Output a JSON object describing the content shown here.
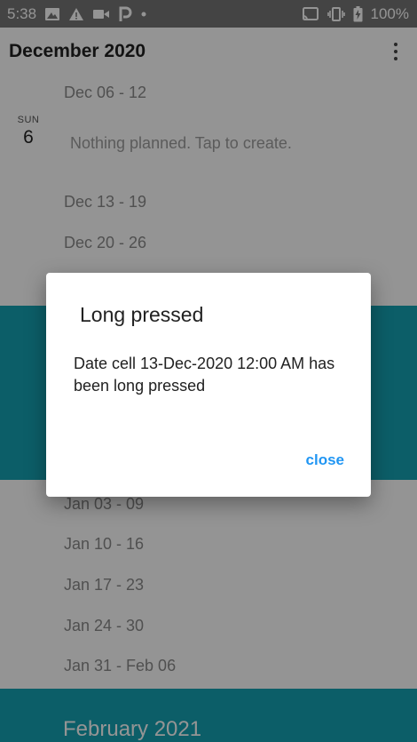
{
  "status_bar": {
    "time": "5:38",
    "battery": "100%",
    "left_icons": [
      "gallery-icon",
      "warning-icon",
      "video-icon",
      "parking-icon",
      "dot-icon"
    ],
    "right_icons": [
      "cast-icon",
      "vibrate-icon",
      "battery-charging-icon"
    ]
  },
  "app_bar": {
    "title": "December 2020",
    "menu_icon": "more-vert-icon"
  },
  "schedule": {
    "week1": "Dec 06 - 12",
    "day": {
      "name": "SUN",
      "number": "6",
      "empty_text": "Nothing planned. Tap to create."
    },
    "week2": "Dec 13 - 19",
    "week3": "Dec 20 - 26",
    "jan_weeks": [
      "Jan 03 - 09",
      "Jan 10 - 16",
      "Jan 17 - 23",
      "Jan 24 - 30",
      "Jan 31 - Feb 06"
    ],
    "next_month": "February 2021",
    "accent": "#15a3b3"
  },
  "dialog": {
    "title": "Long pressed",
    "message": "Date cell 13-Dec-2020 12:00 AM has been long pressed",
    "close_label": "close",
    "button_color": "#2196f3"
  }
}
